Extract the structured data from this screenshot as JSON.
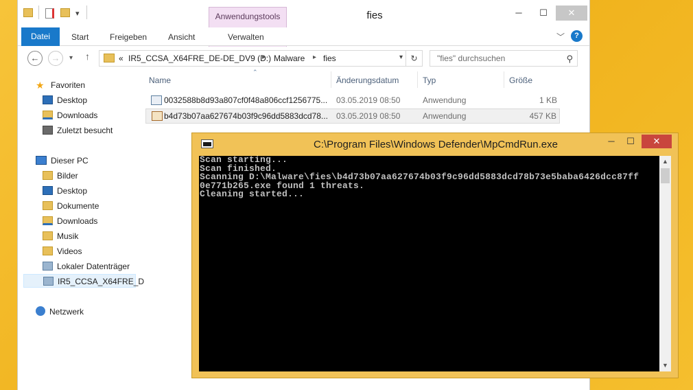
{
  "explorer": {
    "title": "fies",
    "context_tab": "Anwendungstools",
    "window_controls": [
      "─",
      "☐",
      "✕"
    ],
    "ribbon": {
      "file_tab": "Datei",
      "tabs": [
        "Start",
        "Freigeben",
        "Ansicht",
        "Verwalten"
      ]
    },
    "address": {
      "overflow": "«",
      "parts": [
        "IR5_CCSA_X64FRE_DE-DE_DV9 (D:)",
        "Malware",
        "fies"
      ]
    },
    "search": {
      "placeholder": "\"fies\" durchsuchen"
    },
    "sidebar": {
      "favorites": "Favoriten",
      "fav_items": [
        "Desktop",
        "Downloads",
        "Zuletzt besucht"
      ],
      "pc": "Dieser PC",
      "pc_items": [
        "Bilder",
        "Desktop",
        "Dokumente",
        "Downloads",
        "Musik",
        "Videos",
        "Lokaler Datenträger",
        "IR5_CCSA_X64FRE_D"
      ],
      "network": "Netzwerk"
    },
    "columns": [
      "Name",
      "Änderungsdatum",
      "Typ",
      "Größe"
    ],
    "files": [
      {
        "name": "0032588b8d93a807cf0f48a806ccf1256775...",
        "date": "03.05.2019 08:50",
        "type": "Anwendung",
        "size": "1 KB"
      },
      {
        "name": "b4d73b07aa627674b03f9c96dd5883dcd78...",
        "date": "03.05.2019 08:50",
        "type": "Anwendung",
        "size": "457 KB"
      }
    ]
  },
  "console": {
    "title": "C:\\Program Files\\Windows Defender\\MpCmdRun.exe",
    "lines": [
      "Scan starting...",
      "Scan finished.",
      "Scanning D:\\Malware\\fies\\b4d73b07aa627674b03f9c96dd5883dcd78b73e5baba6426dcc87ff",
      "0e771b265.exe found 1 threats.",
      "Cleaning started..."
    ]
  }
}
